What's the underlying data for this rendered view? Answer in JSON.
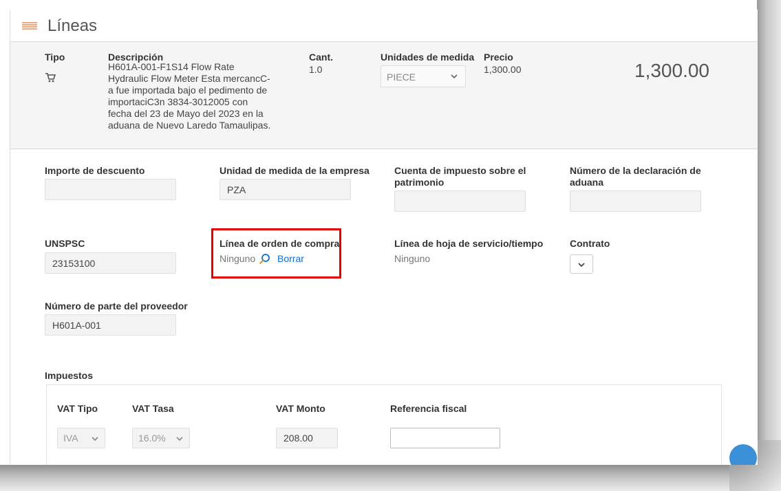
{
  "header": {
    "title": "Líneas"
  },
  "line_summary": {
    "type_label": "Tipo",
    "desc_label": "Descripción",
    "desc_lines": [
      "H601A-001-F1S14 Flow Rate",
      "Hydraulic Flow Meter Esta mercancC-",
      "a fue importada bajo el pedimento de",
      "importaciC3n 3834-3012005 con",
      "fecha del 23 de Mayo del 2023 en la",
      "aduana de Nuevo Laredo Tamaulipas."
    ],
    "qty_label": "Cant.",
    "qty_value": "1.0",
    "uom_label": "Unidades de medida",
    "uom_value": "PIECE",
    "price_label": "Precio",
    "price_value": "1,300.00",
    "total": "1,300.00"
  },
  "fields": {
    "discount_label": "Importe de descuento",
    "company_uom_label": "Unidad de medida de la empresa",
    "company_uom_value": "PZA",
    "asset_tax_label_1": "Cuenta de impuesto sobre el",
    "asset_tax_label_2": "patrimonio",
    "customs_label_1": "Número de la declaración de",
    "customs_label_2": "aduana",
    "unspsc_label": "UNSPSC",
    "unspsc_value": "23153100",
    "po_line_label": "Línea de orden de compra",
    "po_line_value": "Ninguno",
    "po_line_clear": "Borrar",
    "service_sheet_label": "Línea de hoja de servicio/tiempo",
    "service_sheet_value": "Ninguno",
    "contract_label": "Contrato",
    "supplier_part_label": "Número de parte del proveedor",
    "supplier_part_value": "H601A-001"
  },
  "taxes": {
    "section_label": "Impuestos",
    "vat_type_label": "VAT Tipo",
    "vat_type_value": "IVA",
    "vat_rate_label": "VAT Tasa",
    "vat_rate_value": "16.0%",
    "vat_amount_label": "VAT Monto",
    "vat_amount_value": "208.00",
    "fiscal_ref_label": "Referencia fiscal",
    "fiscal_ref_value": ""
  },
  "colors": {
    "highlight": "#e00000",
    "link": "#0a6ed1",
    "header_icon": "#f0a980"
  }
}
